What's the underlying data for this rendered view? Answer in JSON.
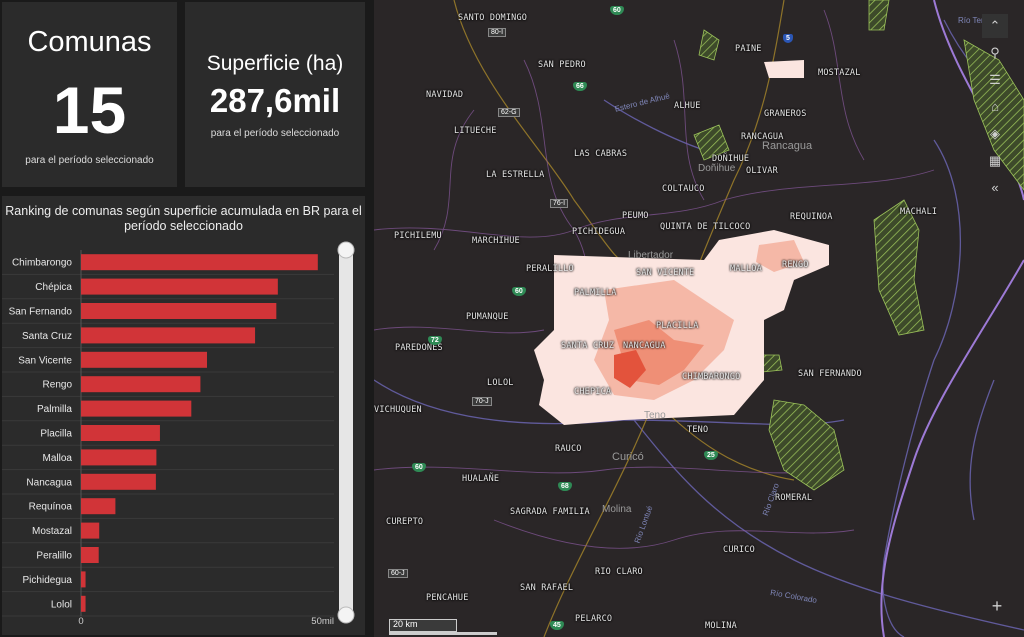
{
  "kpis": {
    "comunas": {
      "title": "Comunas",
      "value": "15",
      "subtitle": "para el período seleccionado"
    },
    "superficie": {
      "title": "Superficie (ha)",
      "value": "287,6mil",
      "subtitle": "para el período seleccionado"
    }
  },
  "ranking": {
    "title_line1": "Ranking de comunas según superficie acumulada en BR para el",
    "title_line2": "período seleccionado",
    "bar_color": "#d13438"
  },
  "chart_data": {
    "type": "bar",
    "orientation": "horizontal",
    "categories": [
      "Chimbarongo",
      "Chépica",
      "San Fernando",
      "Santa Cruz",
      "San Vicente",
      "Rengo",
      "Palmilla",
      "Placilla",
      "Malloa",
      "Nancagua",
      "Requínoa",
      "Mostazal",
      "Peralillo",
      "Pichidegua",
      "Lolol"
    ],
    "values": [
      46800,
      38900,
      38600,
      34400,
      24900,
      23600,
      21800,
      15600,
      14900,
      14800,
      6800,
      3600,
      3500,
      900,
      900
    ],
    "xlim": [
      0,
      50000
    ],
    "tick_labels": [
      "0",
      "50mil"
    ],
    "series_color": "#d13438"
  },
  "map": {
    "background": "#2a2627",
    "legend_colors": [
      "#fde9e6",
      "#f8c4b6",
      "#f1907a",
      "#e0573f"
    ],
    "town_labels": [
      "Libertador",
      "Rancagua",
      "Doñihue",
      "Curicó",
      "Molina",
      "Teno"
    ],
    "commune_labels": [
      "SANTO DOMINGO",
      "SAN PEDRO",
      "NAVIDAD",
      "LITUECHE",
      "LAS CABRAS",
      "LA ESTRELLA",
      "PICHILEMU",
      "MARCHIHUE",
      "PICHIDEGUA",
      "PEUMO",
      "QUINTA DE TILCOCO",
      "REQUINOA",
      "PERALILLO",
      "SAN VICENTE",
      "MALLOA",
      "RENGO",
      "PALMILLA",
      "PUMANQUE",
      "PLACILLA",
      "PAREDONES",
      "SANTA CRUZ",
      "NANCAGUA",
      "LOLOL",
      "CHIMBARONGO",
      "SAN FERNANDO",
      "CHEPICA",
      "HUALAÑE",
      "RAUCO",
      "TENO",
      "VICHUQUEN",
      "ROMERAL",
      "SAGRADA FAMILIA",
      "CUREPTO",
      "CURICO",
      "RIO CLARO",
      "PENCAHUE",
      "SAN RAFAEL",
      "PELARCO",
      "MOLINA",
      "MACHALI",
      "PAINE",
      "MOSTAZAL",
      "GRANEROS",
      "RANCAGUA",
      "DOÑIHUE",
      "OLIVAR",
      "COLTAUCO",
      "ALHUE"
    ],
    "shields": [
      "60",
      "80-I",
      "5",
      "66",
      "62-G",
      "76-I",
      "60",
      "72",
      "70-J",
      "60",
      "68",
      "25",
      "60-J",
      "45"
    ],
    "river_labels": [
      "Estero de Alhué",
      "Río Claro",
      "Río Lontué",
      "Río Colorado",
      "Río Teno"
    ],
    "scale": {
      "label": "20 km"
    }
  },
  "toolbar": {
    "icons": [
      "collapse-up-icon",
      "search-icon",
      "legend-list-icon",
      "home-icon",
      "layers-icon",
      "basemap-grid-icon",
      "collapse-left-icon"
    ],
    "zoom_in": "+"
  }
}
